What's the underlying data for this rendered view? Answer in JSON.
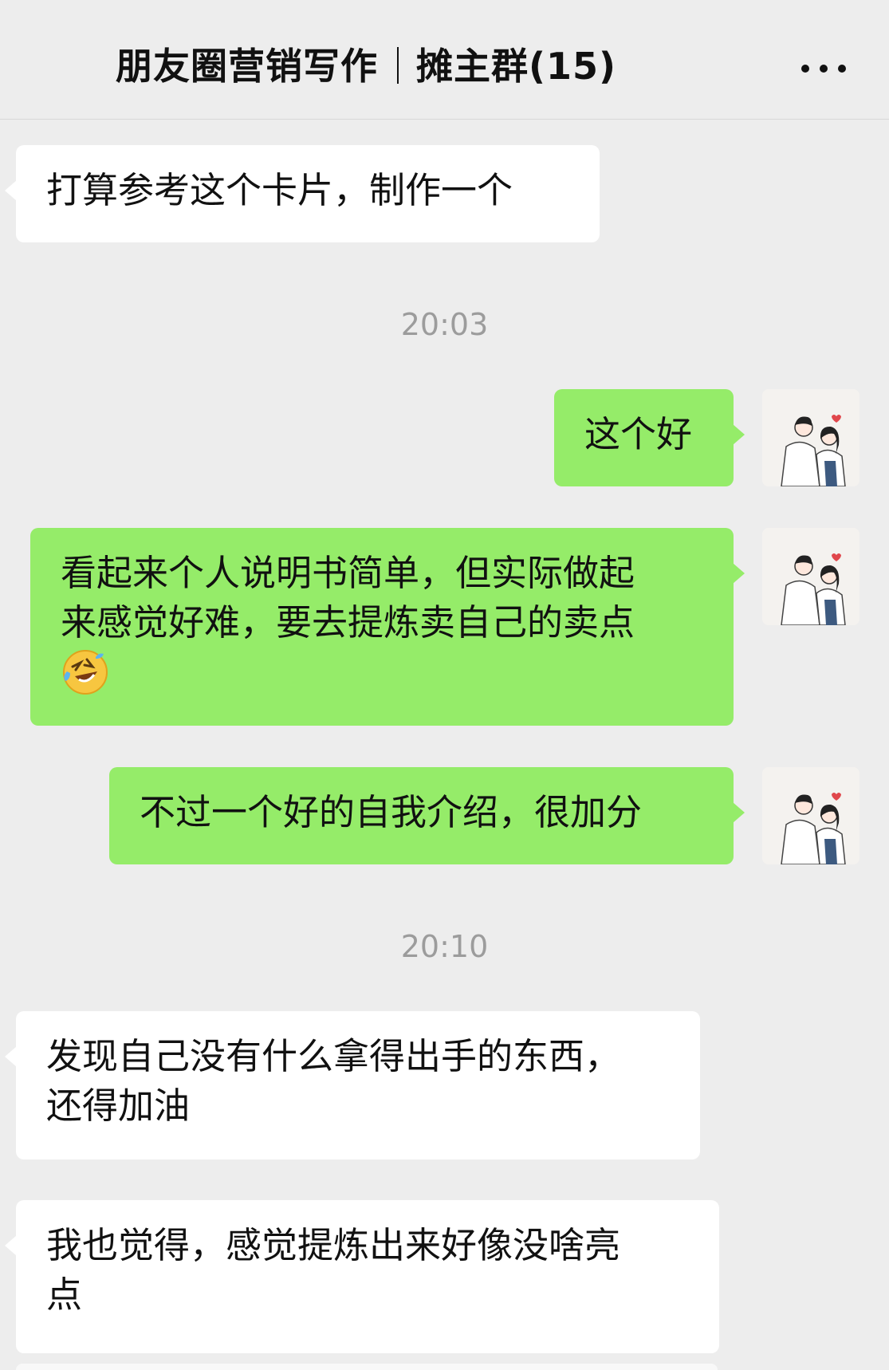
{
  "header": {
    "title": "朋友圈营销写作",
    "group": "摊主群(15)",
    "more_icon": "more-dots-icon"
  },
  "messages": [
    {
      "side": "in",
      "text": "打算参考这个卡片，制作一个"
    },
    {
      "type": "time",
      "text": "20:03"
    },
    {
      "side": "out",
      "text": "这个好"
    },
    {
      "side": "out",
      "line1": "看起来个人说明书简单，但实际做起",
      "line2": "来感觉好难，要去提炼卖自己的卖点",
      "emoji": "rofl-emoji"
    },
    {
      "side": "out",
      "text": "不过一个好的自我介绍，很加分"
    },
    {
      "type": "time",
      "text": "20:10"
    },
    {
      "side": "in",
      "line1": "发现自己没有什么拿得出手的东西，",
      "line2": "还得加油"
    },
    {
      "side": "in",
      "line1": "我也觉得，感觉提炼出来好像没啥亮",
      "line2": "点"
    }
  ],
  "colors": {
    "background": "#ededed",
    "incoming_bubble": "#ffffff",
    "outgoing_bubble": "#95ec69",
    "timestamp": "#9c9c9c"
  }
}
